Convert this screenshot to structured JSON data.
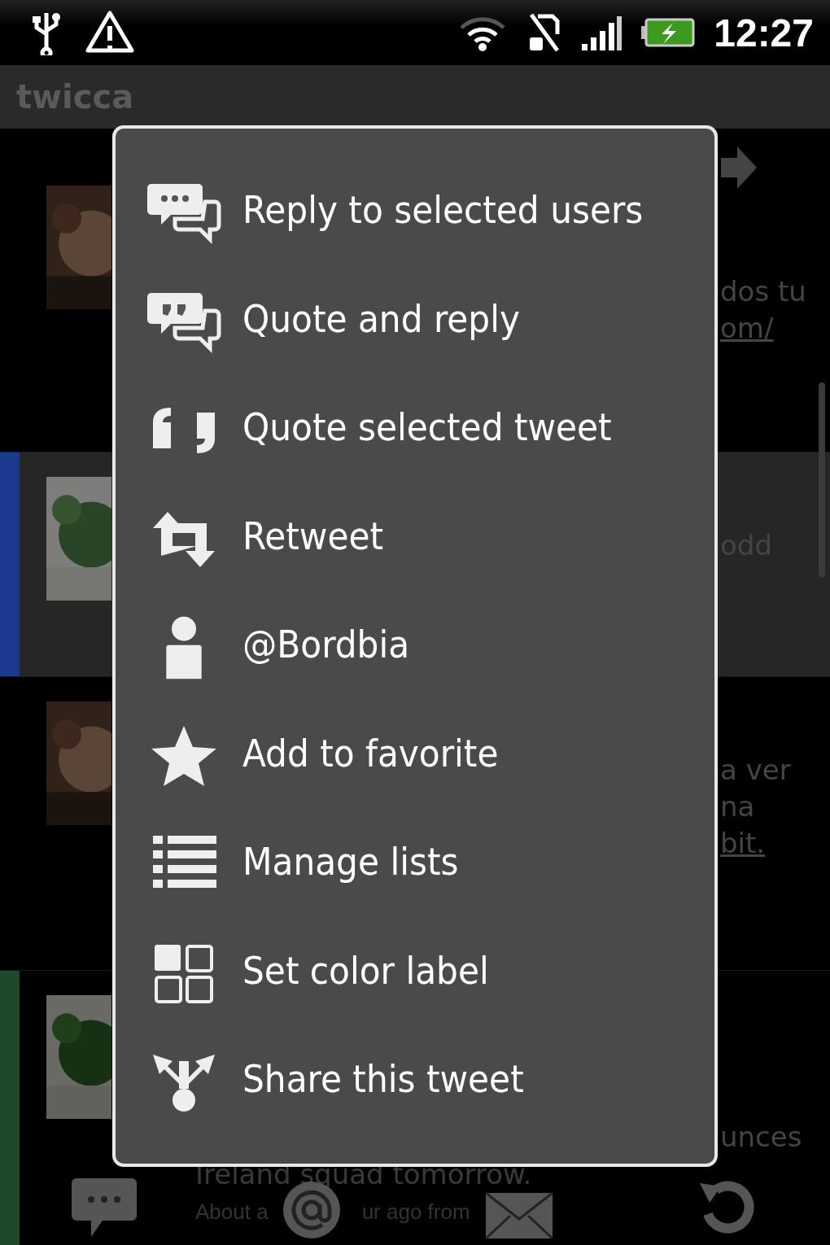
{
  "status_bar": {
    "time": "12:27"
  },
  "app_bar": {
    "title": "twicca"
  },
  "timeline": [
    {
      "highlighted": false,
      "fragments": [
        {
          "text": "dos tu",
          "kind": "text"
        },
        {
          "text": "om/",
          "kind": "link"
        }
      ]
    },
    {
      "highlighted": true,
      "color": "#1a3a8f",
      "fragments": [
        {
          "text": "odd",
          "kind": "text"
        }
      ]
    },
    {
      "highlighted": false,
      "fragments": [
        {
          "text": "a ver",
          "kind": "text"
        },
        {
          "text": "na",
          "kind": "text"
        },
        {
          "text": "bit.",
          "kind": "link"
        }
      ]
    },
    {
      "highlighted": false,
      "color": "#1d4a2a",
      "fragments": [
        {
          "text": "unces",
          "kind": "text"
        }
      ],
      "tail": "Ireland squad tomorrow.",
      "meta": [
        "About a",
        "ur ago from"
      ]
    }
  ],
  "menu": {
    "items": [
      {
        "label": "Reply to selected users",
        "kind": "reply"
      },
      {
        "label": "Quote and reply",
        "kind": "quote-reply"
      },
      {
        "label": "Quote selected tweet",
        "kind": "quote"
      },
      {
        "label": "Retweet",
        "kind": "retweet"
      },
      {
        "label": "@Bordbia",
        "kind": "user"
      },
      {
        "label": "Add to favorite",
        "kind": "star"
      },
      {
        "label": "Manage lists",
        "kind": "list"
      },
      {
        "label": "Set color label",
        "kind": "grid"
      },
      {
        "label": "Share this tweet",
        "kind": "share"
      }
    ]
  }
}
